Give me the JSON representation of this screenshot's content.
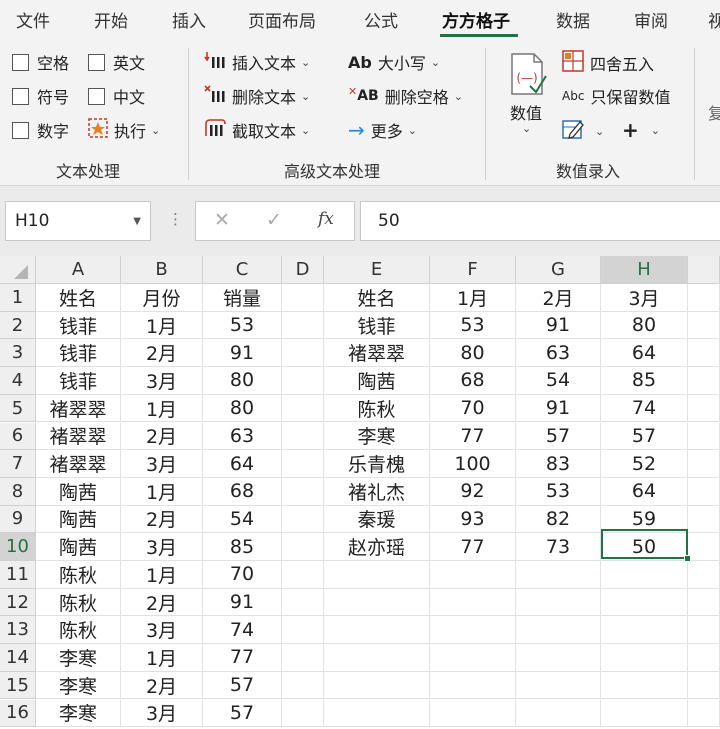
{
  "menu": {
    "tabs": [
      {
        "label": "文件"
      },
      {
        "label": "开始"
      },
      {
        "label": "插入"
      },
      {
        "label": "页面布局"
      },
      {
        "label": "公式"
      },
      {
        "label": "方方格子",
        "active": true
      },
      {
        "label": "数据"
      },
      {
        "label": "审阅"
      },
      {
        "label": "视"
      }
    ]
  },
  "ribbon": {
    "text_processing": {
      "checkboxes": [
        {
          "label": "空格",
          "checked": false
        },
        {
          "label": "英文",
          "checked": false
        },
        {
          "label": "符号",
          "checked": false
        },
        {
          "label": "中文",
          "checked": false
        },
        {
          "label": "数字",
          "checked": false
        }
      ],
      "execute_label": "执行",
      "group_label": "文本处理"
    },
    "advanced_text": {
      "insert_text": "插入文本",
      "delete_text": "删除文本",
      "extract_text": "截取文本",
      "case_label": "大小写",
      "case_icon_text": "Ab",
      "delete_spaces": "删除空格",
      "delete_spaces_icon_text": "AB",
      "more": "更多",
      "group_label": "高级文本处理"
    },
    "numeric_entry": {
      "numeric_label": "数值",
      "numeric_icon_text": "(—)",
      "round_label": "四舍五入",
      "keep_values_label": "只保留数值",
      "keep_values_icon_text": "Abc",
      "plus_symbol": "+",
      "group_label": "数值录入"
    },
    "cut_off_text": "复"
  },
  "formula_bar": {
    "name_box": "H10",
    "cancel_symbol": "✕",
    "enter_symbol": "✓",
    "fx_symbol": "fx",
    "dots_symbol": "⋮",
    "value": "50"
  },
  "sheet": {
    "columns": [
      "A",
      "B",
      "C",
      "D",
      "E",
      "F",
      "G",
      "H"
    ],
    "selected_column": "H",
    "rows": [
      "1",
      "2",
      "3",
      "4",
      "5",
      "6",
      "7",
      "8",
      "9",
      "10",
      "11",
      "12",
      "13",
      "14",
      "15",
      "16"
    ],
    "selected_row": "10",
    "active_cell": "H10",
    "data": [
      [
        "姓名",
        "月份",
        "销量",
        "",
        "姓名",
        "1月",
        "2月",
        "3月"
      ],
      [
        "钱菲",
        "1月",
        "53",
        "",
        "钱菲",
        "53",
        "91",
        "80"
      ],
      [
        "钱菲",
        "2月",
        "91",
        "",
        "褚翠翠",
        "80",
        "63",
        "64"
      ],
      [
        "钱菲",
        "3月",
        "80",
        "",
        "陶茜",
        "68",
        "54",
        "85"
      ],
      [
        "褚翠翠",
        "1月",
        "80",
        "",
        "陈秋",
        "70",
        "91",
        "74"
      ],
      [
        "褚翠翠",
        "2月",
        "63",
        "",
        "李寒",
        "77",
        "57",
        "57"
      ],
      [
        "褚翠翠",
        "3月",
        "64",
        "",
        "乐青槐",
        "100",
        "83",
        "52"
      ],
      [
        "陶茜",
        "1月",
        "68",
        "",
        "褚礼杰",
        "92",
        "53",
        "64"
      ],
      [
        "陶茜",
        "2月",
        "54",
        "",
        "秦瑗",
        "93",
        "82",
        "59"
      ],
      [
        "陶茜",
        "3月",
        "85",
        "",
        "赵亦瑶",
        "77",
        "73",
        "50"
      ],
      [
        "陈秋",
        "1月",
        "70",
        "",
        "",
        "",
        "",
        ""
      ],
      [
        "陈秋",
        "2月",
        "91",
        "",
        "",
        "",
        "",
        ""
      ],
      [
        "陈秋",
        "3月",
        "74",
        "",
        "",
        "",
        "",
        ""
      ],
      [
        "李寒",
        "1月",
        "77",
        "",
        "",
        "",
        "",
        ""
      ],
      [
        "李寒",
        "2月",
        "57",
        "",
        "",
        "",
        "",
        ""
      ],
      [
        "李寒",
        "3月",
        "57",
        "",
        "",
        "",
        "",
        ""
      ]
    ]
  },
  "colors": {
    "accent": "#217346",
    "header_bg": "#efefef",
    "selected_header_bg": "#d3d3d3",
    "gridline": "#e1e1e1",
    "insert_icon": "#c0392b",
    "arrow_icon": "#2e86de"
  }
}
